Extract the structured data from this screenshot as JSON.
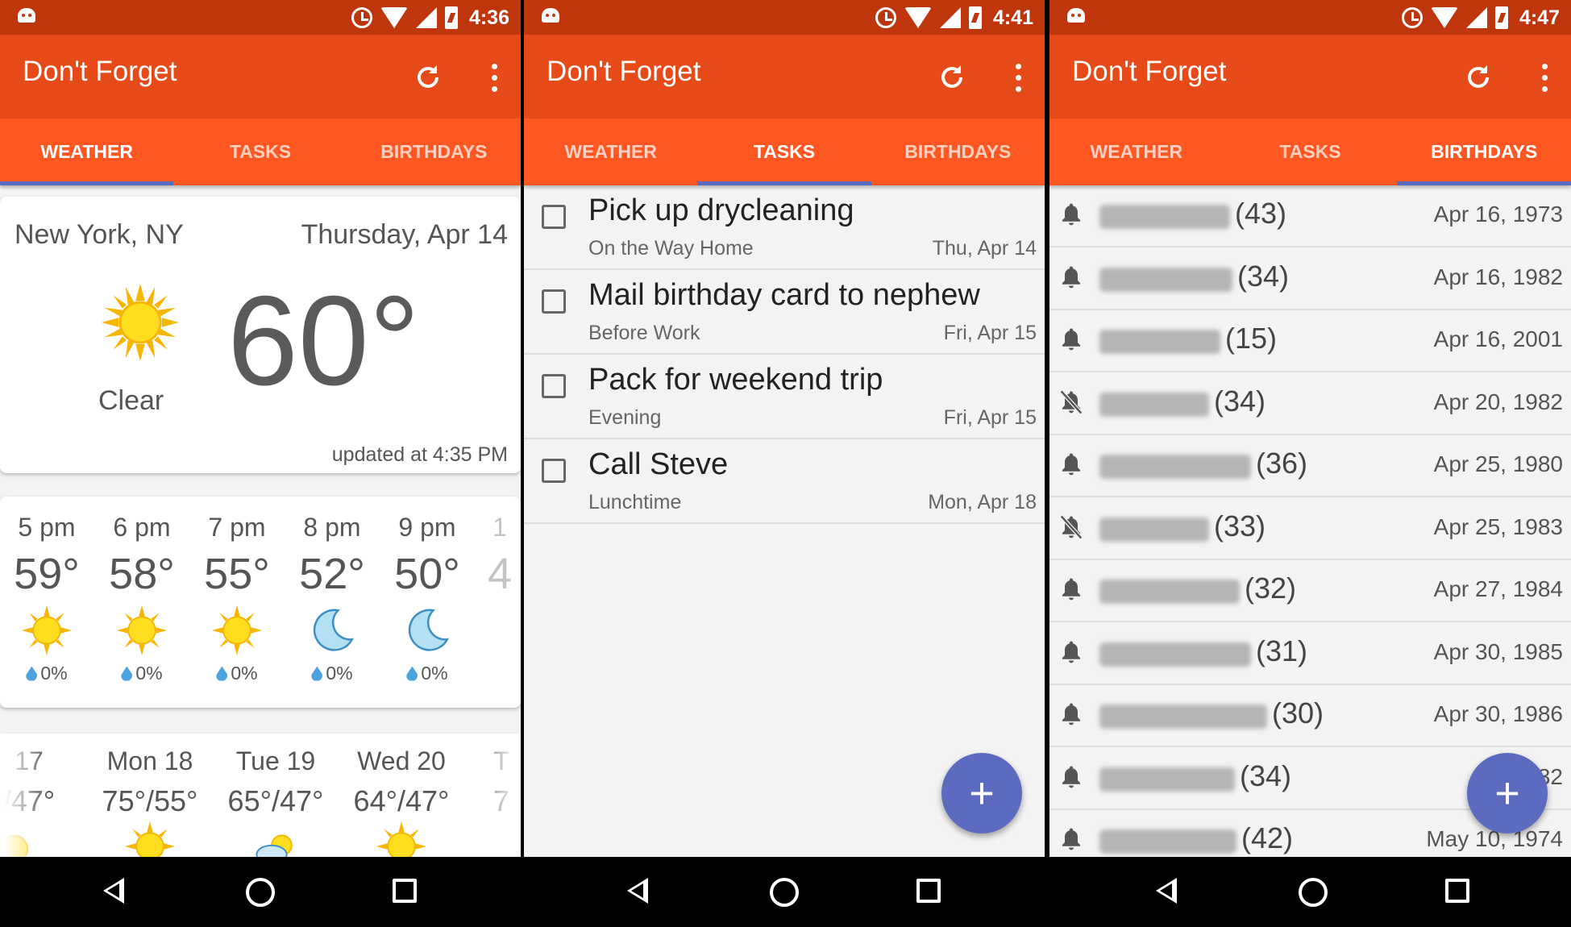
{
  "app": {
    "title": "Don't Forget"
  },
  "colors": {
    "status_bar": "#bf360c",
    "toolbar": "#e64a19",
    "tabs": "#ff5722",
    "accent": "#5c6bc0"
  },
  "tabs": [
    "WEATHER",
    "TASKS",
    "BIRTHDAYS"
  ],
  "screens": [
    {
      "time": "4:36",
      "active_tab": "WEATHER"
    },
    {
      "time": "4:41",
      "active_tab": "TASKS"
    },
    {
      "time": "4:47",
      "active_tab": "BIRTHDAYS"
    }
  ],
  "weather": {
    "location": "New York, NY",
    "date": "Thursday, Apr 14",
    "condition": "Clear",
    "condition_icon": "sun-icon",
    "temperature": "60°",
    "updated": "updated at 4:35 PM",
    "hourly": [
      {
        "time": "5 pm",
        "temp": "59°",
        "icon": "sun-icon",
        "precip": "0%"
      },
      {
        "time": "6 pm",
        "temp": "58°",
        "icon": "sun-icon",
        "precip": "0%"
      },
      {
        "time": "7 pm",
        "temp": "55°",
        "icon": "sun-icon",
        "precip": "0%"
      },
      {
        "time": "8 pm",
        "temp": "52°",
        "icon": "moon-icon",
        "precip": "0%"
      },
      {
        "time": "9 pm",
        "temp": "50°",
        "icon": "moon-icon",
        "precip": "0%"
      }
    ],
    "daily": [
      {
        "name": "Mon 18",
        "temp": "75°/55°",
        "icon": "sun-icon"
      },
      {
        "name": "Tue 19",
        "temp": "65°/47°",
        "icon": "cloud-sun-icon"
      },
      {
        "name": "Wed 20",
        "temp": "64°/47°",
        "icon": "sun-icon"
      }
    ],
    "daily_partial_left": {
      "name": "17",
      "temp": "/47°"
    },
    "daily_partial_right": {
      "name": "T",
      "temp": "7"
    },
    "hourly_partial": {
      "time": "1",
      "temp": "4"
    }
  },
  "tasks": [
    {
      "title": "Pick up drycleaning",
      "when": "On the Way Home",
      "date": "Thu, Apr 14"
    },
    {
      "title": "Mail birthday card to nephew",
      "when": "Before Work",
      "date": "Fri, Apr 15"
    },
    {
      "title": "Pack for weekend trip",
      "when": "Evening",
      "date": "Fri, Apr 15"
    },
    {
      "title": "Call Steve",
      "when": "Lunchtime",
      "date": "Mon, Apr 18"
    }
  ],
  "birthdays": [
    {
      "age": "(43)",
      "date": "Apr 16, 1973",
      "notify": true
    },
    {
      "age": "(34)",
      "date": "Apr 16, 1982",
      "notify": true
    },
    {
      "age": "(15)",
      "date": "Apr 16, 2001",
      "notify": true
    },
    {
      "age": "(34)",
      "date": "Apr 20, 1982",
      "notify": false
    },
    {
      "age": "(36)",
      "date": "Apr 25, 1980",
      "notify": true
    },
    {
      "age": "(33)",
      "date": "Apr 25, 1983",
      "notify": false
    },
    {
      "age": "(32)",
      "date": "Apr 27, 1984",
      "notify": true
    },
    {
      "age": "(31)",
      "date": "Apr 30, 1985",
      "notify": true
    },
    {
      "age": "(30)",
      "date": "Apr 30, 1986",
      "notify": true
    },
    {
      "age": "(34)",
      "date": "Ma  32",
      "notify": true
    },
    {
      "age": "(42)",
      "date": "May 10, 1974",
      "notify": true
    }
  ],
  "fab_label": "+"
}
